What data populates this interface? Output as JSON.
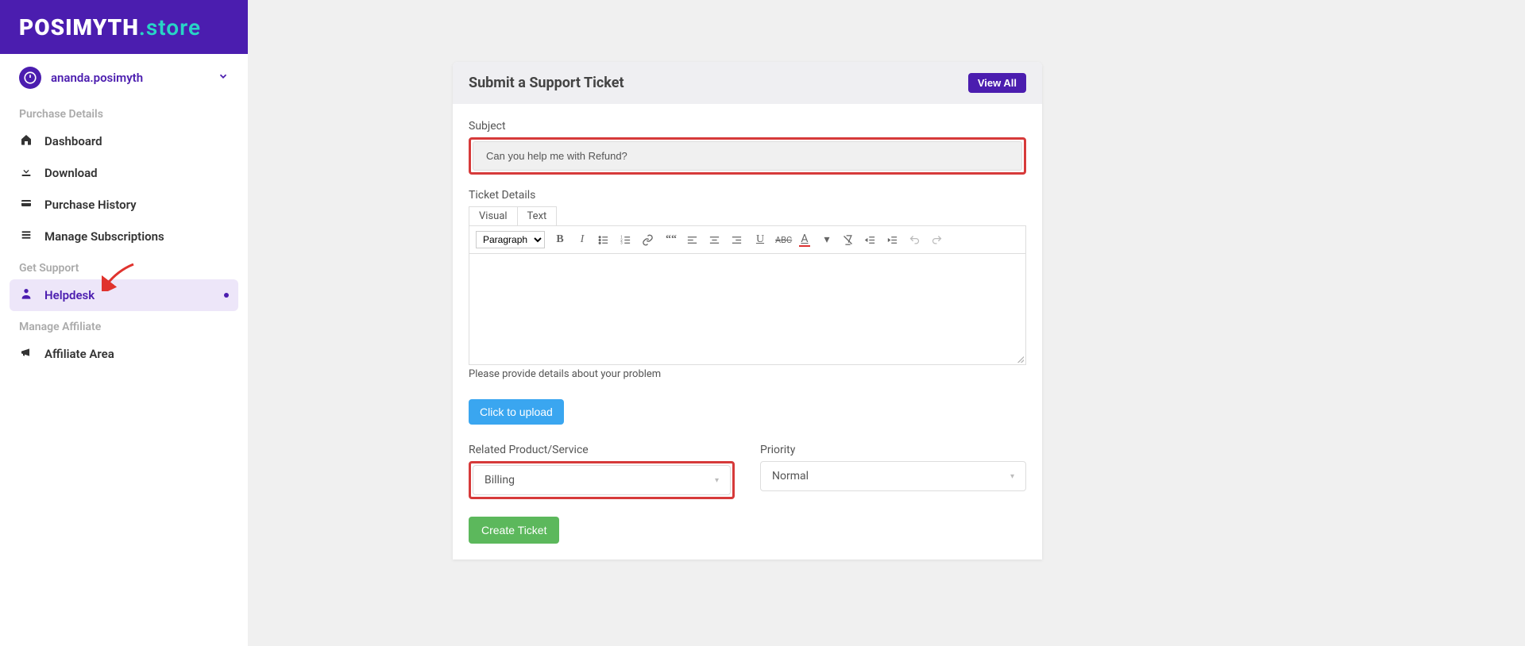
{
  "logo": {
    "brand": "POSIMYTH",
    "suffix": ".store"
  },
  "user": {
    "name": "ananda.posimyth"
  },
  "sections": {
    "purchase": "Purchase Details",
    "support": "Get Support",
    "affiliate": "Manage Affiliate"
  },
  "nav": {
    "dashboard": "Dashboard",
    "download": "Download",
    "purchase_history": "Purchase History",
    "subscriptions": "Manage Subscriptions",
    "helpdesk": "Helpdesk",
    "affiliate_area": "Affiliate Area"
  },
  "card": {
    "title": "Submit a Support Ticket",
    "view_all": "View All"
  },
  "form": {
    "subject_label": "Subject",
    "subject_value": "Can you help me with Refund?",
    "details_label": "Ticket Details",
    "editor_tabs": {
      "visual": "Visual",
      "text": "Text"
    },
    "paragraph_option": "Paragraph",
    "helper": "Please provide details about your problem",
    "upload_label": "Click to upload",
    "related_label": "Related Product/Service",
    "related_value": "Billing",
    "priority_label": "Priority",
    "priority_value": "Normal",
    "submit_label": "Create Ticket"
  }
}
